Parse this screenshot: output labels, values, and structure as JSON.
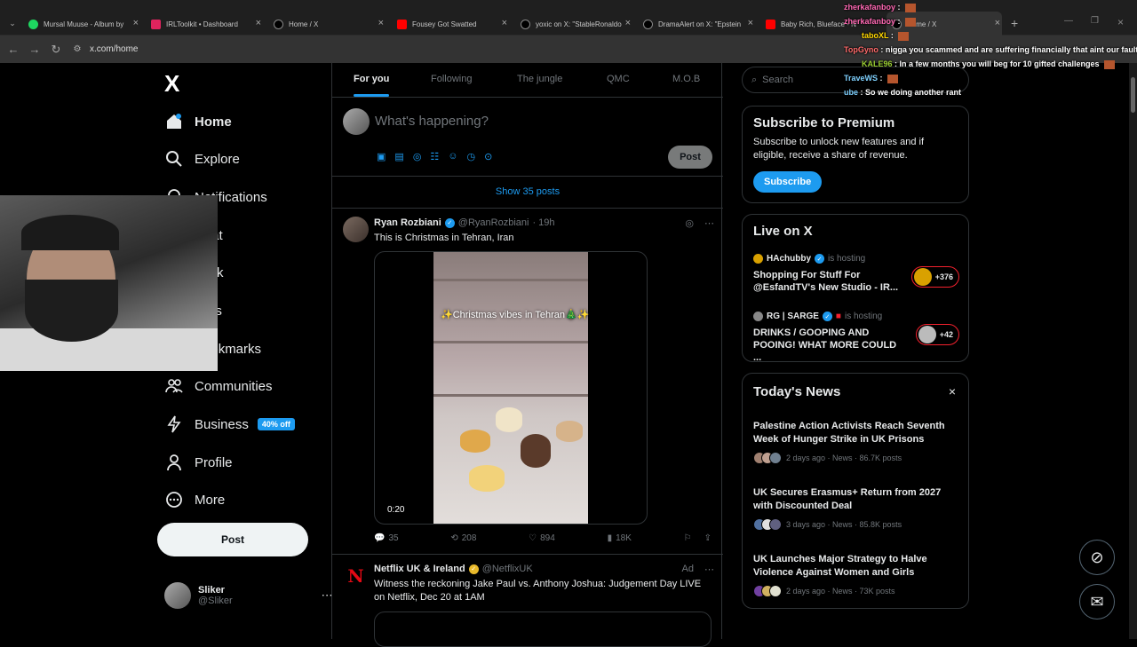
{
  "browser": {
    "tabs": [
      {
        "title": "Mursal Muuse - Album by",
        "color": "#1ed760"
      },
      {
        "title": "IRLToolkit • Dashboard",
        "color": "#e0245e"
      },
      {
        "title": "Home / X",
        "color": "#ffffff"
      },
      {
        "title": "Fousey Got Swatted",
        "color": "#ff0000"
      },
      {
        "title": "yoxic on X: \"StableRonaldo",
        "color": "#ffffff"
      },
      {
        "title": "DramaAlert on X: \"Epstein",
        "color": "#ffffff"
      },
      {
        "title": "Baby Rich, Blueface - N",
        "color": "#ff0000"
      },
      {
        "title": "Home / X",
        "color": "#ffffff"
      }
    ],
    "url": "x.com/home"
  },
  "sidebar": {
    "logo": "X",
    "items": [
      {
        "label": "Home",
        "icon": "home-icon"
      },
      {
        "label": "Explore",
        "icon": "search-icon"
      },
      {
        "label": "Notifications",
        "icon": "bell-icon"
      },
      {
        "label": "Chat",
        "icon": "mail-icon"
      },
      {
        "label": "Grok",
        "icon": "grok-icon"
      },
      {
        "label": "Lists",
        "icon": "list-icon"
      },
      {
        "label": "Bookmarks",
        "icon": "bookmark-icon"
      },
      {
        "label": "Communities",
        "icon": "people-icon"
      },
      {
        "label": "Business",
        "icon": "lightning-icon",
        "badge": "40% off"
      },
      {
        "label": "Profile",
        "icon": "person-icon"
      },
      {
        "label": "More",
        "icon": "more-circle-icon"
      }
    ],
    "post_label": "Post",
    "profile": {
      "name": "Sliker",
      "handle": "@Sliker"
    }
  },
  "main": {
    "tabs": [
      "For you",
      "Following",
      "The jungle",
      "QMC",
      "M.O.B"
    ],
    "compose_placeholder": "What's happening?",
    "compose_post": "Post",
    "show_posts": "Show 35 posts",
    "tweet": {
      "name": "Ryan Rozbiani",
      "handle": "@RyanRozbiani",
      "time": "· 19h",
      "text": "This is Christmas in Tehran, Iran",
      "video_caption": "✨Christmas vibes in Tehran🎄✨",
      "video_duration": "0:20",
      "replies": "35",
      "reposts": "208",
      "likes": "894",
      "views": "18K"
    },
    "ad": {
      "name": "Netflix UK & Ireland",
      "handle": "@NetflixUK",
      "label": "Ad",
      "text": "Witness the reckoning Jake Paul vs. Anthony Joshua: Judgement Day LIVE on Netflix, Dec 20 at 1AM"
    }
  },
  "right": {
    "search_placeholder": "Search",
    "premium": {
      "title": "Subscribe to Premium",
      "text": "Subscribe to unlock new features and if eligible, receive a share of revenue.",
      "button": "Subscribe"
    },
    "live": {
      "title": "Live on X",
      "items": [
        {
          "host": "HAchubby",
          "status": "is hosting",
          "title": "Shopping For Stuff For @EsfandTV's New Studio - IR...",
          "count": "+376"
        },
        {
          "host": "RG | SARGE",
          "status": "is hosting",
          "title": "DRINKS / GOOPING AND POOING! WHAT MORE COULD ...",
          "count": "+42"
        }
      ]
    },
    "news": {
      "title": "Today's News",
      "items": [
        {
          "title": "Palestine Action Activists Reach Seventh Week of Hunger Strike in UK Prisons",
          "meta": "2 days ago · News · 86.7K posts"
        },
        {
          "title": "UK Secures Erasmus+ Return from 2027 with Discounted Deal",
          "meta": "3 days ago · News · 85.8K posts"
        },
        {
          "title": "UK Launches Major Strategy to Halve Violence Against Women and Girls",
          "meta": "2 days ago · News · 73K posts"
        }
      ]
    }
  },
  "chat": [
    {
      "user": "zherkafanboy",
      "msg": ""
    },
    {
      "user": "zherkafanboy",
      "msg": ""
    },
    {
      "user": "taboXL",
      "msg": ""
    },
    {
      "user": "TopGyno",
      "msg": "nigga you scammed and are suffering financially that aint our fault"
    },
    {
      "user": "KALE96",
      "msg": "In a few months you will beg for 10 gifted challenges"
    },
    {
      "user": "TraveWS",
      "msg": ""
    },
    {
      "user": "ube",
      "msg": "So we doing another rant"
    }
  ]
}
